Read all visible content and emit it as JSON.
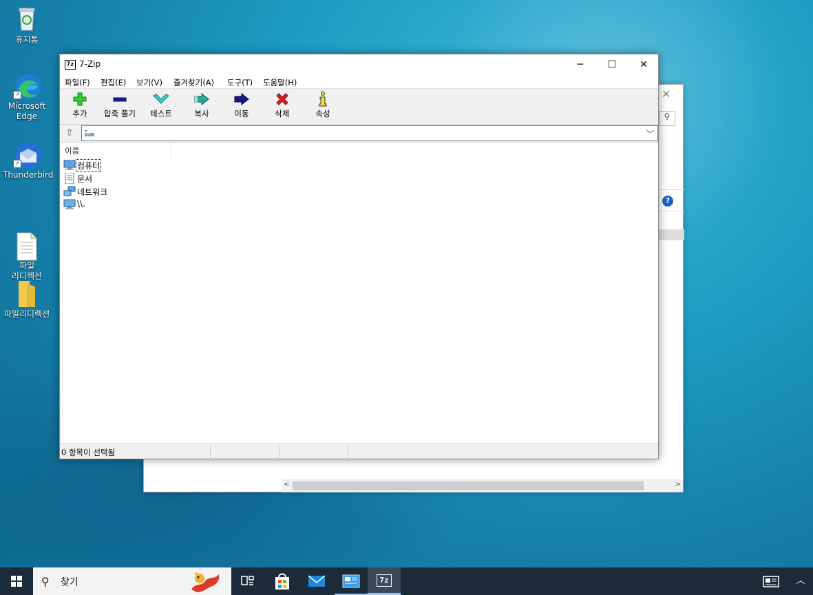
{
  "desktop": {
    "icons": [
      {
        "label": "휴지통",
        "icon": "recycle-bin-icon"
      },
      {
        "label": "Microsoft Edge",
        "icon": "edge-icon"
      },
      {
        "label": "Thunderbird",
        "icon": "thunderbird-icon"
      },
      {
        "label": "파일\n리디렉션",
        "icon": "text-file-icon"
      },
      {
        "label": "파일리디렉션",
        "icon": "folder-icon"
      }
    ]
  },
  "window": {
    "title": "7-Zip",
    "logo": "7z",
    "controls": {
      "minimize": "─",
      "maximize": "☐",
      "close": "✕"
    }
  },
  "menu": [
    "파일(F)",
    "편집(E)",
    "보기(V)",
    "즐겨찾기(A)",
    "도구(T)",
    "도움말(H)"
  ],
  "toolbar": [
    {
      "label": "추가",
      "icon": "add-icon"
    },
    {
      "label": "압축 풀기",
      "icon": "extract-icon"
    },
    {
      "label": "테스트",
      "icon": "test-icon"
    },
    {
      "label": "복사",
      "icon": "copy-icon"
    },
    {
      "label": "이동",
      "icon": "move-icon"
    },
    {
      "label": "삭제",
      "icon": "delete-icon"
    },
    {
      "label": "속성",
      "icon": "info-icon"
    }
  ],
  "address": {
    "value": ""
  },
  "list": {
    "column": "이름",
    "items": [
      {
        "label": "컴퓨터",
        "icon": "computer-icon",
        "focused": true
      },
      {
        "label": "문서",
        "icon": "document-icon"
      },
      {
        "label": "네트워크",
        "icon": "network-icon"
      },
      {
        "label": "\\\\.",
        "icon": "monitor-icon"
      }
    ]
  },
  "status": {
    "text": "0 항목이 선택됨"
  },
  "taskbar": {
    "search_placeholder": "찾기",
    "apps": [
      "task-view-icon",
      "store-icon",
      "mail-icon",
      "control-panel-icon",
      "7zip-icon"
    ],
    "zip_label": "7z"
  },
  "colors": {
    "accent": "#0078d7",
    "taskbar": "#1c2b3a"
  }
}
